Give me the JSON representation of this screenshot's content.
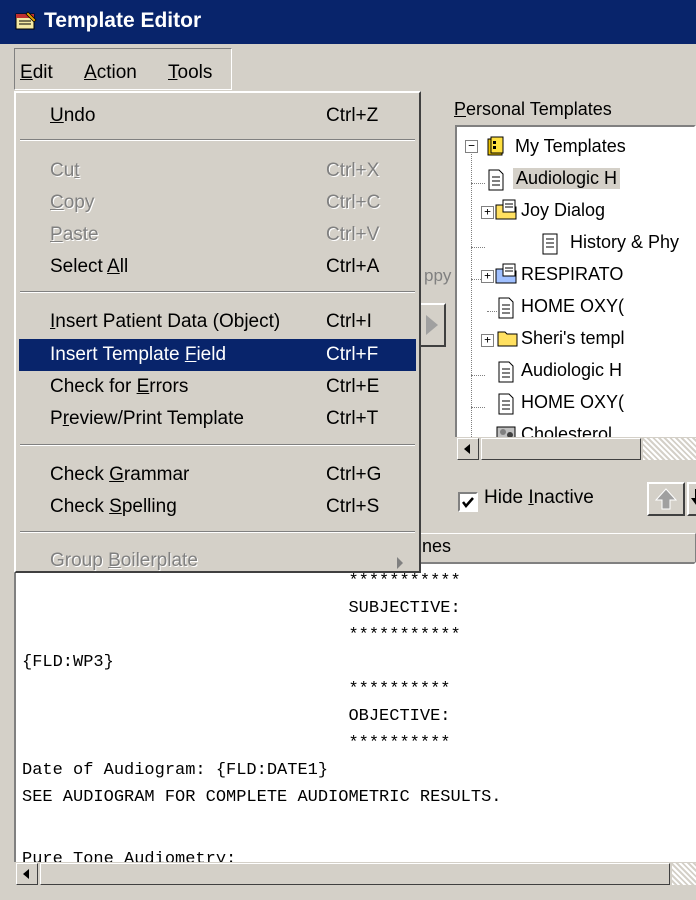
{
  "window": {
    "title": "Template Editor"
  },
  "menubar": {
    "edit": "Edit",
    "action": "Action",
    "tools": "Tools"
  },
  "edit_menu": {
    "undo": {
      "label": "Undo",
      "shortcut": "Ctrl+Z"
    },
    "cut": {
      "label": "Cut",
      "shortcut": "Ctrl+X"
    },
    "copy": {
      "label": "Copy",
      "shortcut": "Ctrl+C"
    },
    "paste": {
      "label": "Paste",
      "shortcut": "Ctrl+V"
    },
    "select_all": {
      "label": "Select All",
      "shortcut": "Ctrl+A"
    },
    "insert_patient_data": {
      "label": "Insert Patient Data (Object)",
      "shortcut": "Ctrl+I"
    },
    "insert_template_field": {
      "label": "Insert Template Field",
      "shortcut": "Ctrl+F"
    },
    "check_errors": {
      "label": "Check for Errors",
      "shortcut": "Ctrl+E"
    },
    "preview_print": {
      "label": "Preview/Print Template",
      "shortcut": "Ctrl+T"
    },
    "check_grammar": {
      "label": "Check Grammar",
      "shortcut": "Ctrl+G"
    },
    "check_spelling": {
      "label": "Check Spelling",
      "shortcut": "Ctrl+S"
    },
    "group_boilerplate": {
      "label": "Group Boilerplate"
    }
  },
  "personal_templates": {
    "label": "Personal Templates",
    "items": [
      "My Templates",
      "Audiologic H",
      "Joy Dialog",
      "History & Phy",
      "RESPIRATO",
      "HOME OXY(",
      "Sheri's templ",
      "Audiologic H",
      "HOME OXY(",
      "Cholesterol"
    ],
    "hide_inactive": "Hide Inactive",
    "hide_inactive_checked": true
  },
  "partial_labels": {
    "copy_fragment": "ppy",
    "nes_fragment": "nes"
  },
  "editor": {
    "lines": [
      "                                ***********",
      "                                SUBJECTIVE:",
      "                                ***********",
      "{FLD:WP3}",
      "                                **********",
      "                                OBJECTIVE:",
      "                                **********",
      "Date of Audiogram: {FLD:DATE1}",
      "SEE AUDIOGRAM FOR COMPLETE AUDIOMETRIC RESULTS.",
      "",
      "Pure Tone Audiometry:"
    ]
  }
}
